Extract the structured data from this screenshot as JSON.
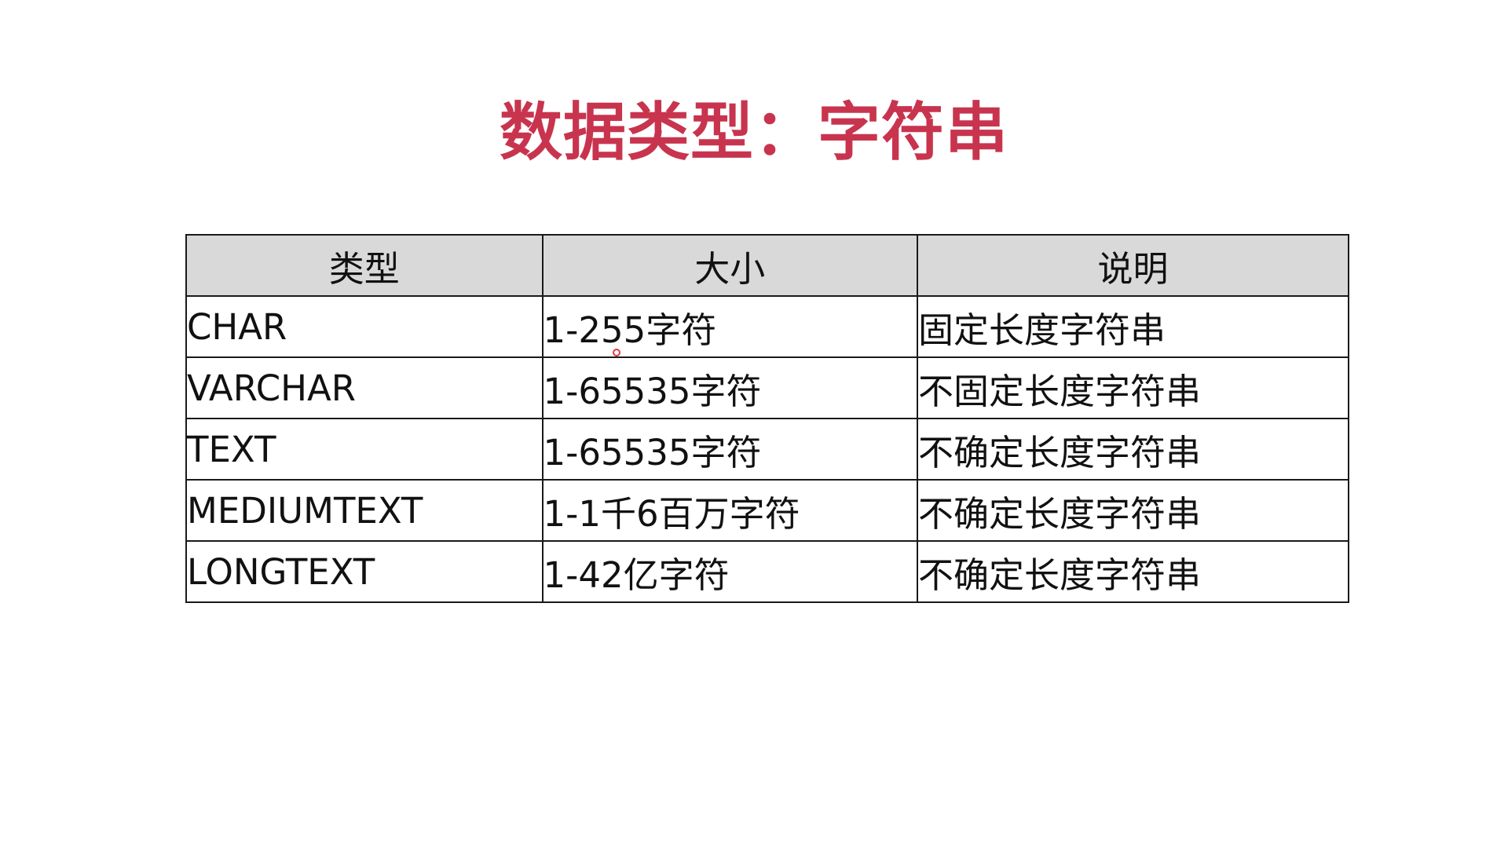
{
  "slide": {
    "title": "数据类型：字符串"
  },
  "table": {
    "headers": [
      "类型",
      "大小",
      "说明"
    ],
    "rows": [
      [
        "CHAR",
        "1-255字符",
        "固定长度字符串"
      ],
      [
        "VARCHAR",
        "1-65535字符",
        "不固定长度字符串"
      ],
      [
        "TEXT",
        "1-65535字符",
        "不确定长度字符串"
      ],
      [
        "MEDIUMTEXT",
        "1-1千6百万字符",
        "不确定长度字符串"
      ],
      [
        "LONGTEXT",
        "1-42亿字符",
        "不确定长度字符串"
      ]
    ]
  },
  "colors": {
    "title": "#c8344e",
    "header_bg": "#d9d9d9",
    "border": "#1a1a1a",
    "cursor": "#e23a3a"
  },
  "icons": {
    "cursor": "cursor-dot-icon"
  }
}
